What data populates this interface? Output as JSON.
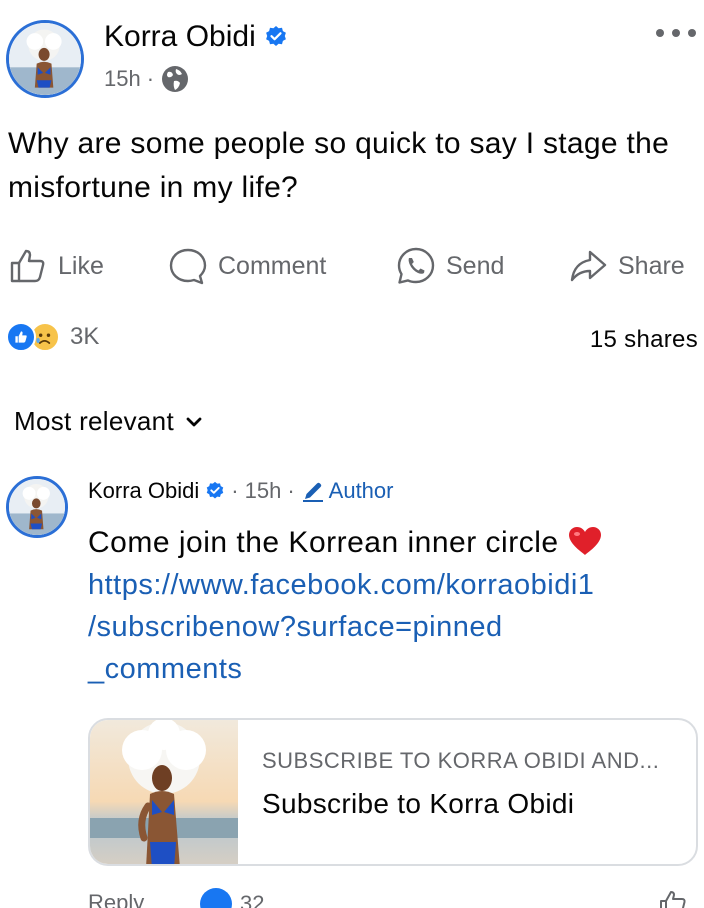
{
  "post": {
    "author": "Korra Obidi",
    "time": "15h",
    "separator": "·",
    "text": "Why are some people so quick to say I stage the misfortune in my life?",
    "privacy_icon": "globe-icon",
    "verified_icon": "verified-badge-icon"
  },
  "actions": {
    "like": "Like",
    "comment": "Comment",
    "send": "Send",
    "share": "Share"
  },
  "reactions": {
    "count": "3K",
    "types": [
      "like",
      "sad"
    ],
    "shares": "15 shares"
  },
  "comments_sort": {
    "label": "Most relevant"
  },
  "comment": {
    "author": "Korra Obidi",
    "separator": "·",
    "time": "15h",
    "author_tag": "Author",
    "text": "Come join the Korrean inner circle",
    "link_line1": "https://www.facebook.com/korraobidi1",
    "link_line2": "/subscribenow?surface=pinned",
    "link_line3": "_comments",
    "reply_label": "Reply",
    "reaction_count": "32"
  },
  "link_card": {
    "kicker": "SUBSCRIBE TO KORRA OBIDI AND...",
    "title": "Subscribe to Korra Obidi"
  },
  "colors": {
    "facebook_blue": "#1877f2",
    "link_blue": "#1a5fb4",
    "muted_text": "#65676b",
    "avatar_ring": "#2b6fd6"
  }
}
